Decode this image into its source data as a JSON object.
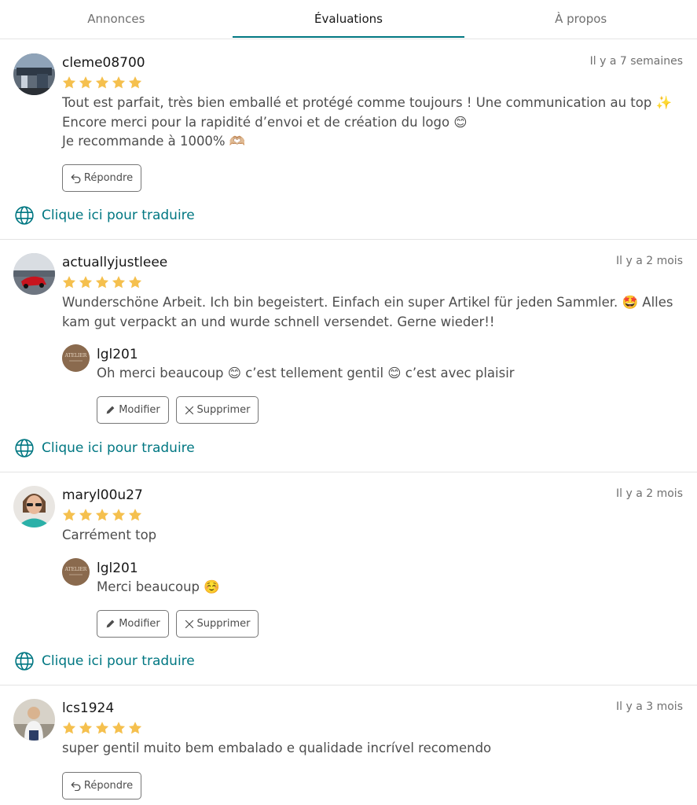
{
  "tabs": [
    {
      "label": "Annonces"
    },
    {
      "label": "Évaluations"
    },
    {
      "label": "À propos"
    }
  ],
  "accent_color": "#007782",
  "star_color": "#f5c04e",
  "translate_label": "Clique ici pour traduire",
  "reply_button_label": "Répondre",
  "edit_button_label": "Modifier",
  "delete_button_label": "Supprimer",
  "reviews": [
    {
      "username": "cleme08700",
      "date": "Il y a 7 semaines",
      "rating": 5,
      "text": "Tout est parfait, très bien emballé et protégé comme toujours ! Une communication au top ✨\nEncore merci pour la rapidité d’envoi et de création du logo 😊\nJe recommande à 1000% 🫶🏼"
    },
    {
      "username": "actuallyjustleee",
      "date": "Il y a 2 mois",
      "rating": 5,
      "text": "Wunderschöne Arbeit. Ich bin begeistert. Einfach ein super Artikel für jeden Sammler. 🤩 Alles\nkam gut verpackt an und wurde schnell versendet. Gerne wieder!!",
      "reply": {
        "username": "lgl201",
        "text": "Oh merci beaucoup 😊 c’est tellement gentil 😊 c’est avec plaisir"
      }
    },
    {
      "username": "maryl00u27",
      "date": "Il y a 2 mois",
      "rating": 5,
      "text": "Carrément top",
      "reply": {
        "username": "lgl201",
        "text": "Merci beaucoup ☺️"
      }
    },
    {
      "username": "lcs1924",
      "date": "Il y a 3 mois",
      "rating": 5,
      "text": "super gentil muito bem embalado e qualidade incrível recomendo"
    }
  ],
  "reply_avatar_text": "ATELIER"
}
